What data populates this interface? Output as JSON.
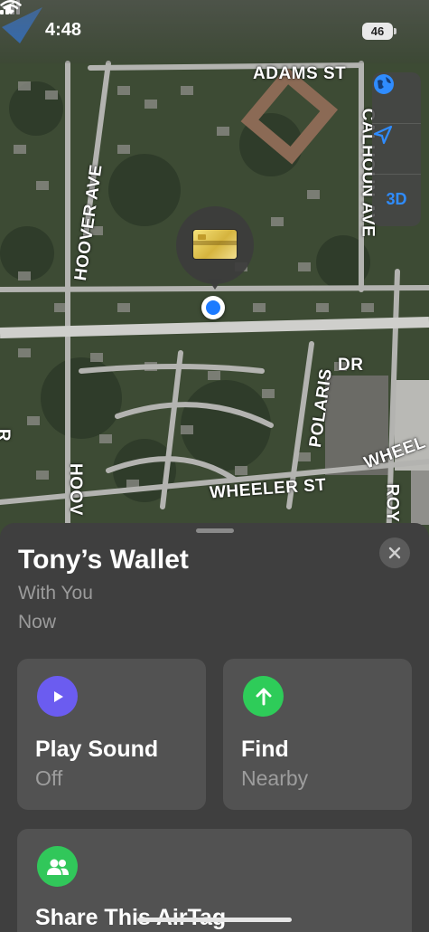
{
  "status_bar": {
    "time": "4:48",
    "battery": "46"
  },
  "map": {
    "streets": {
      "adams": "ADAMS ST",
      "calhoun": "CALHOUN AVE",
      "hoover": "HOOVER AVE",
      "hoover_lower": "HOOV",
      "polaris": "POLARIS",
      "dr": "DR",
      "wheeler": "WHEELER ST",
      "wheeler_right": "WHEEL",
      "roy": "ROY",
      "edge_r": "R"
    },
    "controls": {
      "globe": "globe-icon",
      "location": "location-arrow-icon",
      "view_3d": "3D"
    }
  },
  "item": {
    "title": "Tony’s Wallet",
    "subtitle": "With You",
    "time": "Now"
  },
  "actions": {
    "play_sound": {
      "label": "Play Sound",
      "sub": "Off",
      "icon": "play-icon"
    },
    "find": {
      "label": "Find",
      "sub": "Nearby",
      "icon": "arrow-up-icon"
    },
    "share": {
      "label": "Share This AirTag",
      "icon": "people-icon"
    }
  },
  "colors": {
    "sheet": "#3f3f3f",
    "card": "#525252",
    "accent_blue": "#2f8cff",
    "play_purple": "#6b5cf0",
    "find_green": "#2ecc59"
  }
}
